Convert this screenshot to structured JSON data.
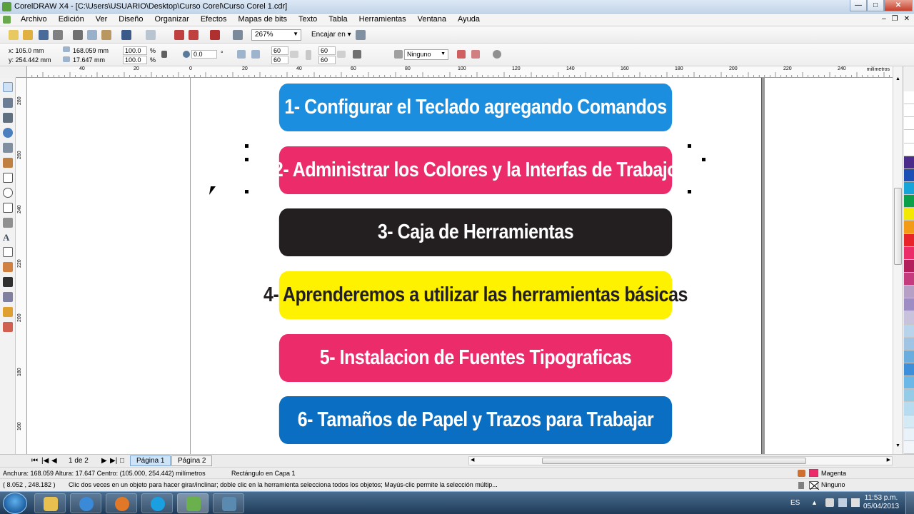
{
  "window": {
    "title": "CorelDRAW X4 - [C:\\Users\\USUARIO\\Desktop\\Curso Corel\\Curso Corel 1.cdr]"
  },
  "menu": [
    "Archivo",
    "Edición",
    "Ver",
    "Diseño",
    "Organizar",
    "Efectos",
    "Mapas de bits",
    "Texto",
    "Tabla",
    "Herramientas",
    "Ventana",
    "Ayuda"
  ],
  "toolbar": {
    "zoom": "267%",
    "snap_label": "Encajar en"
  },
  "property_bar": {
    "x": "x: 105.0 mm",
    "y": "y: 254.442 mm",
    "width": "168.059 mm",
    "height": "17.647 mm",
    "scale_w": "100.0",
    "scale_h": "100.0",
    "pct": "%",
    "rotation": "0.0",
    "deg": "°",
    "corner_tl": "60",
    "corner_bl": "60",
    "corner_tr": "60",
    "corner_br": "60",
    "outline": "Ninguno"
  },
  "ruler": {
    "unit": "milímetros",
    "h_labels": [
      "40",
      "20",
      "0",
      "20",
      "40",
      "60",
      "80",
      "100",
      "120",
      "140",
      "160",
      "180",
      "200",
      "220",
      "240"
    ],
    "v_labels": [
      "280",
      "260",
      "240",
      "220",
      "200",
      "180",
      "160"
    ]
  },
  "banners": [
    {
      "text": "1- Configurar el Teclado agregando Comandos",
      "bg": "#1b8ee0",
      "fg": "#ffffff"
    },
    {
      "text": "2- Administrar los Colores y la Interfas de Trabajo",
      "bg": "#ec2b6a",
      "fg": "#ffffff"
    },
    {
      "text": "3- Caja de Herramientas",
      "bg": "#231f20",
      "fg": "#ffffff"
    },
    {
      "text": "4- Aprenderemos a utilizar las herramientas básicas",
      "bg": "#fff200",
      "fg": "#231f20"
    },
    {
      "text": "5- Instalacion de Fuentes Tipograficas",
      "bg": "#ec2b6a",
      "fg": "#ffffff"
    },
    {
      "text": "6- Tamaños de Papel y Trazos para Trabajar",
      "bg": "#0a6fc2",
      "fg": "#ffffff"
    }
  ],
  "pages": {
    "counter": "1 de 2",
    "tabs": [
      "Página 1",
      "Página 2"
    ]
  },
  "status": {
    "dims": "Anchura: 168.059  Altura: 17.647  Centro: (105.000, 254.442)  milímetros",
    "object": "Rectángulo en Capa 1",
    "fill_name": "Magenta",
    "fill_color": "#ec2b6a",
    "outline_name": "Ninguno",
    "coords": "( 8.052 , 248.182 )",
    "hint": "Clic dos veces en un objeto para hacer girar/inclinar; doble clic en la herramienta selecciona todos los objetos; Mayús-clic permite la selección múltip..."
  },
  "palette": [
    "#ffffff",
    "#ffffff",
    "#ffffff",
    "#ffffff",
    "#ffffff",
    "#4b2c8a",
    "#1c50b4",
    "#17a4d8",
    "#0aa049",
    "#f2e800",
    "#f39a17",
    "#e8232a",
    "#ec2b6a",
    "#b21f5a",
    "#c43c7e",
    "#b6a0c6",
    "#9e8dc4",
    "#c8c2dc",
    "#b8d4ec",
    "#a0c4e4",
    "#6aaee0",
    "#3c8fd8",
    "#6ab8e8",
    "#94cce8",
    "#b8dcef",
    "#d4eaf4",
    "#e8f2f8",
    "#f2f6fa"
  ],
  "taskbar": {
    "lang": "ES",
    "time": "11:53 p.m.",
    "date": "05/04/2013"
  }
}
